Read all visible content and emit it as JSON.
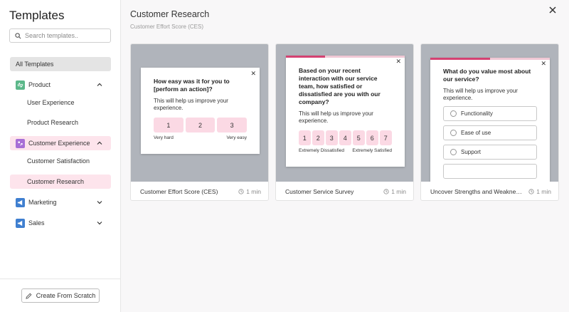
{
  "sidebar": {
    "title": "Templates",
    "search_placeholder": "Search templates..",
    "all_templates": "All Templates",
    "categories": [
      {
        "label": "Product",
        "icon": "product-icon",
        "color": "#5cb88a",
        "sub": [
          "User Experience",
          "Product Research"
        ]
      },
      {
        "label": "Customer Experience",
        "icon": "customer-experience-icon",
        "color": "#a86fd6",
        "sub": [
          "Customer Satisfaction",
          "Customer Research"
        ]
      },
      {
        "label": "Marketing",
        "icon": "megaphone-icon",
        "color": "#3f7fd0"
      },
      {
        "label": "Sales",
        "icon": "megaphone-icon",
        "color": "#3f7fd0"
      }
    ],
    "create_button": "Create From Scratch"
  },
  "main": {
    "title": "Customer Research",
    "subtitle": "Customer Effort Score (CES)",
    "cards": [
      {
        "name": "Customer Effort Score (CES)",
        "time": "1 min",
        "question": "How easy was it for you to [perform an action]?",
        "description": "This will help us improve your experience.",
        "scale": [
          "1",
          "2",
          "3"
        ],
        "low_label": "Very hard",
        "high_label": "Very easy"
      },
      {
        "name": "Customer Service Survey",
        "time": "1 min",
        "progress": 0.33,
        "question": "Based on your recent interaction with our service team, how satisfied or dissatisfied are you with our company?",
        "description": "This will help us improve your experience.",
        "scale": [
          "1",
          "2",
          "3",
          "4",
          "5",
          "6",
          "7"
        ],
        "low_label": "Extremely Dissatisfied",
        "high_label": "Extremely Satisfied"
      },
      {
        "name": "Uncover Strengths and Weaknesses",
        "time": "1 min",
        "progress": 0.5,
        "question": "What do you value most about our service?",
        "description": "This will help us improve your experience.",
        "options": [
          "Functionality",
          "Ease of use",
          "Support"
        ]
      }
    ]
  },
  "colors": {
    "accent_pink": "#d44272",
    "pink_light": "#fde4ec",
    "preview_gray": "#b0b4bb"
  }
}
